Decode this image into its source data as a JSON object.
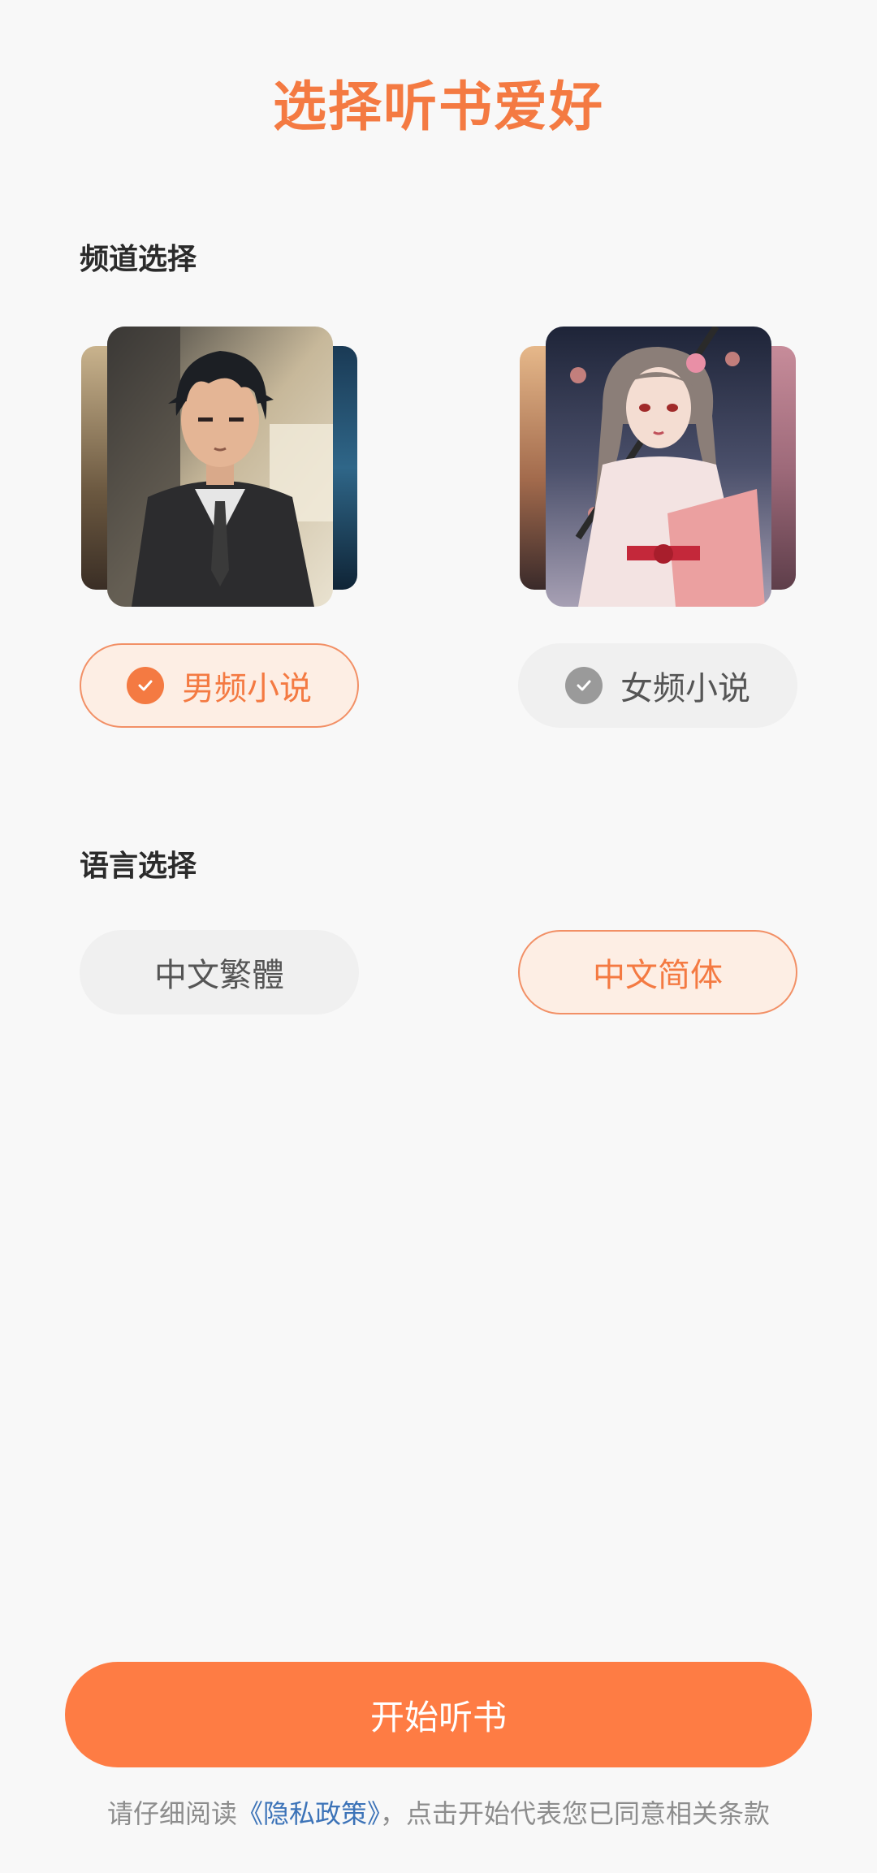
{
  "title": "选择听书爱好",
  "channel": {
    "label": "频道选择",
    "options": [
      {
        "label": "男频小说",
        "selected": true
      },
      {
        "label": "女频小说",
        "selected": false
      }
    ]
  },
  "language": {
    "label": "语言选择",
    "options": [
      {
        "label": "中文繁體",
        "selected": false
      },
      {
        "label": "中文简体",
        "selected": true
      }
    ]
  },
  "cta": {
    "label": "开始听书"
  },
  "footer": {
    "prefix": "请仔细阅读",
    "link": "《隐私政策》",
    "suffix": "，点击开始代表您已同意相关条款"
  },
  "colors": {
    "accent": "#fe7c44",
    "accent_text": "#f47a42",
    "selected_bg": "#fdeee4",
    "unselected_bg": "#f0f0f0",
    "link": "#3c73b8"
  }
}
